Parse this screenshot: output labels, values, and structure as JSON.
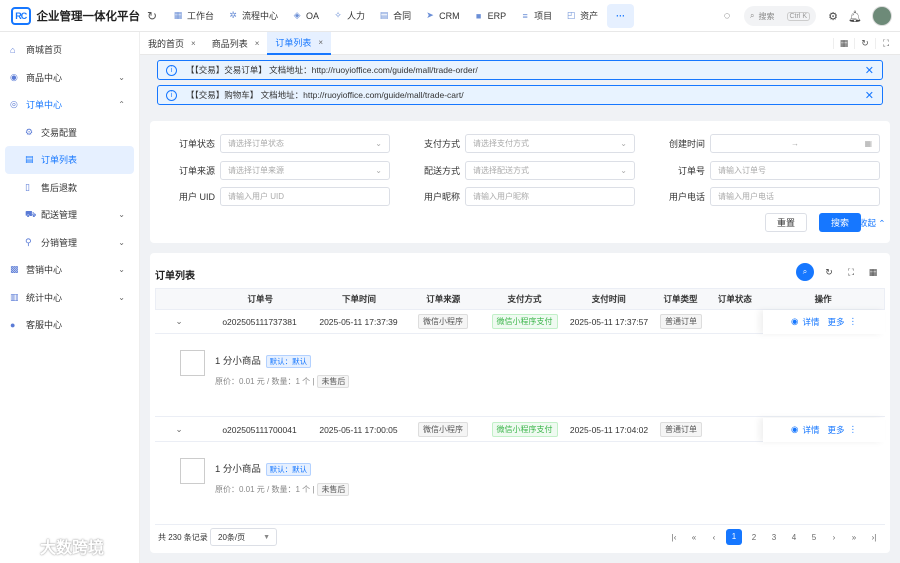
{
  "app": {
    "logo_text": "RC",
    "title": "企业管理一体化平台"
  },
  "topmenu": [
    {
      "icon": "dashboard-icon",
      "glyph": "▦",
      "label": "工作台"
    },
    {
      "icon": "flow-icon",
      "glyph": "✲",
      "label": "流程中心"
    },
    {
      "icon": "oa-icon",
      "glyph": "◈",
      "label": "OA"
    },
    {
      "icon": "people-icon",
      "glyph": "✧",
      "label": "人力"
    },
    {
      "icon": "contract-icon",
      "glyph": "▤",
      "label": "合同"
    },
    {
      "icon": "crm-icon",
      "glyph": "➤",
      "label": "CRM"
    },
    {
      "icon": "erp-icon",
      "glyph": "■",
      "label": "ERP"
    },
    {
      "icon": "project-icon",
      "glyph": "≡",
      "label": "项目"
    },
    {
      "icon": "asset-icon",
      "glyph": "◰",
      "label": "资产"
    }
  ],
  "topmenu_more": "···",
  "search": {
    "placeholder": "搜索",
    "shortcut": "Ctrl K"
  },
  "sidebar": {
    "items": [
      {
        "label": "商城首页",
        "glyph": "⌂",
        "icon": "home-icon",
        "level": 0
      },
      {
        "label": "商品中心",
        "glyph": "◉",
        "icon": "goods-icon",
        "level": 0,
        "arrow": "⌄"
      },
      {
        "label": "订单中心",
        "glyph": "◎",
        "icon": "order-icon",
        "level": 0,
        "arrow": "⌃",
        "open": true
      },
      {
        "label": "交易配置",
        "glyph": "⚙",
        "icon": "config-icon",
        "level": 1
      },
      {
        "label": "订单列表",
        "glyph": "▤",
        "icon": "list-icon",
        "level": 1,
        "active": true
      },
      {
        "label": "售后退款",
        "glyph": "▯",
        "icon": "refund-icon",
        "level": 1
      },
      {
        "label": "配送管理",
        "glyph": "⛟",
        "icon": "delivery-icon",
        "level": 1,
        "arrow": "⌄"
      },
      {
        "label": "分销管理",
        "glyph": "⚲",
        "icon": "distribution-icon",
        "level": 1,
        "arrow": "⌄"
      },
      {
        "label": "营销中心",
        "glyph": "▩",
        "icon": "marketing-icon",
        "level": 0,
        "arrow": "⌄"
      },
      {
        "label": "统计中心",
        "glyph": "▥",
        "icon": "statistics-icon",
        "level": 0,
        "arrow": "⌄"
      },
      {
        "label": "客服中心",
        "glyph": "●",
        "icon": "service-icon",
        "level": 0
      }
    ]
  },
  "tabs": [
    {
      "label": "我的首页",
      "close": "×"
    },
    {
      "label": "商品列表",
      "close": "×"
    },
    {
      "label": "订单列表",
      "close": "×",
      "active": true
    }
  ],
  "alerts": [
    {
      "text": "【【交易】交易订单】 文档地址：http://ruoyioffice.com/guide/mall/trade-order/"
    },
    {
      "text": "【【交易】购物车】 文档地址：http://ruoyioffice.com/guide/mall/trade-cart/"
    }
  ],
  "filters": {
    "order_status": {
      "label": "订单状态",
      "placeholder": "请选择订单状态"
    },
    "pay_method": {
      "label": "支付方式",
      "placeholder": "请选择支付方式"
    },
    "create_time": {
      "label": "创建时间",
      "separator": "→"
    },
    "order_source": {
      "label": "订单来源",
      "placeholder": "请选择订单来源"
    },
    "delivery": {
      "label": "配送方式",
      "placeholder": "请选择配送方式"
    },
    "order_no": {
      "label": "订单号",
      "placeholder": "请输入订单号"
    },
    "user_uid": {
      "label": "用户 UID",
      "placeholder": "请输入用户 UID"
    },
    "nickname": {
      "label": "用户昵称",
      "placeholder": "请输入用户昵称"
    },
    "phone": {
      "label": "用户电话",
      "placeholder": "请输入用户电话"
    },
    "reset": "重置",
    "search": "搜索",
    "collapse": "收起 ⌃"
  },
  "list": {
    "title": "订单列表",
    "columns": [
      "",
      "订单号",
      "下单时间",
      "订单来源",
      "支付方式",
      "支付时间",
      "订单类型",
      "订单状态",
      "操作"
    ],
    "orders": [
      {
        "no": "o202505111737381",
        "time": "2025-05-11 17:37:39",
        "source": "微信小程序",
        "pay": "微信小程序支付",
        "paytime": "2025-05-11 17:37:57",
        "type": "普通订单",
        "detail": "详情",
        "more": "更多",
        "product": {
          "name": "1 分小商品",
          "spec": "默认：默认",
          "price": "原价：0.01 元 / 数量：1 个 |",
          "status": "未售后"
        }
      },
      {
        "no": "o202505111700041",
        "time": "2025-05-11 17:00:05",
        "source": "微信小程序",
        "pay": "微信小程序支付",
        "paytime": "2025-05-11 17:04:02",
        "type": "普通订单",
        "detail": "详情",
        "more": "更多",
        "product": {
          "name": "1 分小商品",
          "spec": "默认：默认",
          "price": "原价：0.01 元 / 数量：1 个 |",
          "status": "未售后"
        }
      }
    ]
  },
  "pagination": {
    "total": "共 230 条记录",
    "page_size": "20条/页",
    "pages": [
      "1",
      "2",
      "3",
      "4",
      "5"
    ],
    "current": "1"
  },
  "watermark": "大数跨境",
  "colors": {
    "primary": "#1677ff",
    "success": "#3bb54a"
  }
}
